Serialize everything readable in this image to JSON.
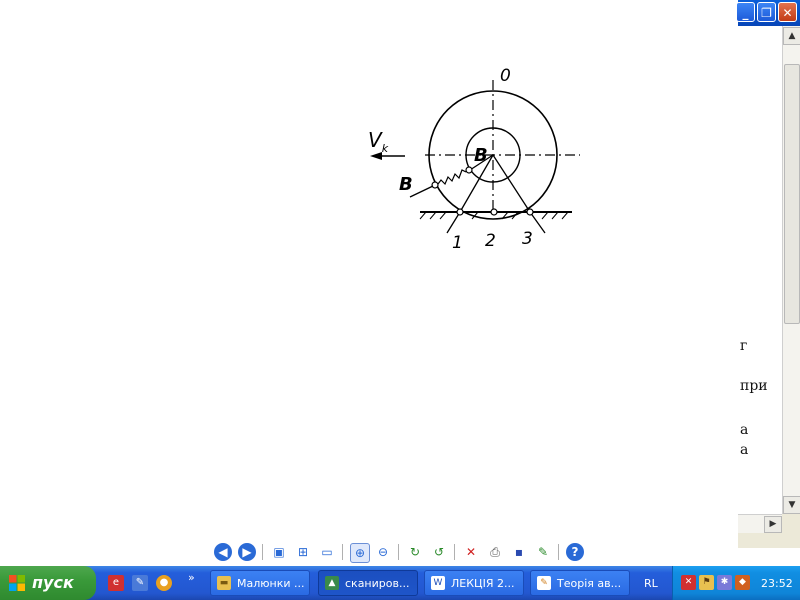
{
  "viewer": {
    "figure": {
      "labels": {
        "zero": "0",
        "vk_main": "V",
        "vk_sub": "k",
        "b_center": "B",
        "b_left": "B",
        "one": "1",
        "two": "2",
        "three": "3"
      }
    },
    "toolbar": {
      "icons": [
        "prev-image-icon",
        "next-image-icon",
        "best-fit-icon",
        "actual-size-icon",
        "slideshow-icon",
        "zoom-in-icon",
        "zoom-out-icon",
        "rotate-clockwise-icon",
        "rotate-counterclockwise-icon",
        "delete-icon",
        "print-icon",
        "save-icon",
        "edit-icon",
        "help-icon"
      ]
    }
  },
  "background_window": {
    "doc_lines": [
      "г",
      "при",
      "а",
      "а"
    ]
  },
  "taskbar": {
    "start_label": "пуск",
    "more_chevron": "»",
    "tasks": [
      {
        "label": "Малюнки ...",
        "icon": "folder-icon",
        "active": false
      },
      {
        "label": "сканиров...",
        "icon": "image-viewer-icon",
        "active": true
      },
      {
        "label": "ЛЕКЦІЯ 2...",
        "icon": "word-document-icon",
        "active": false
      },
      {
        "label": "Теорія ав...",
        "icon": "paint-icon",
        "active": false
      }
    ],
    "language": "RL",
    "clock": "23:52"
  },
  "colors": {
    "taskbar_blue": "#245edb",
    "start_green": "#3a9a3a",
    "tray_blue": "#118ee2",
    "close_red": "#c23c17"
  }
}
